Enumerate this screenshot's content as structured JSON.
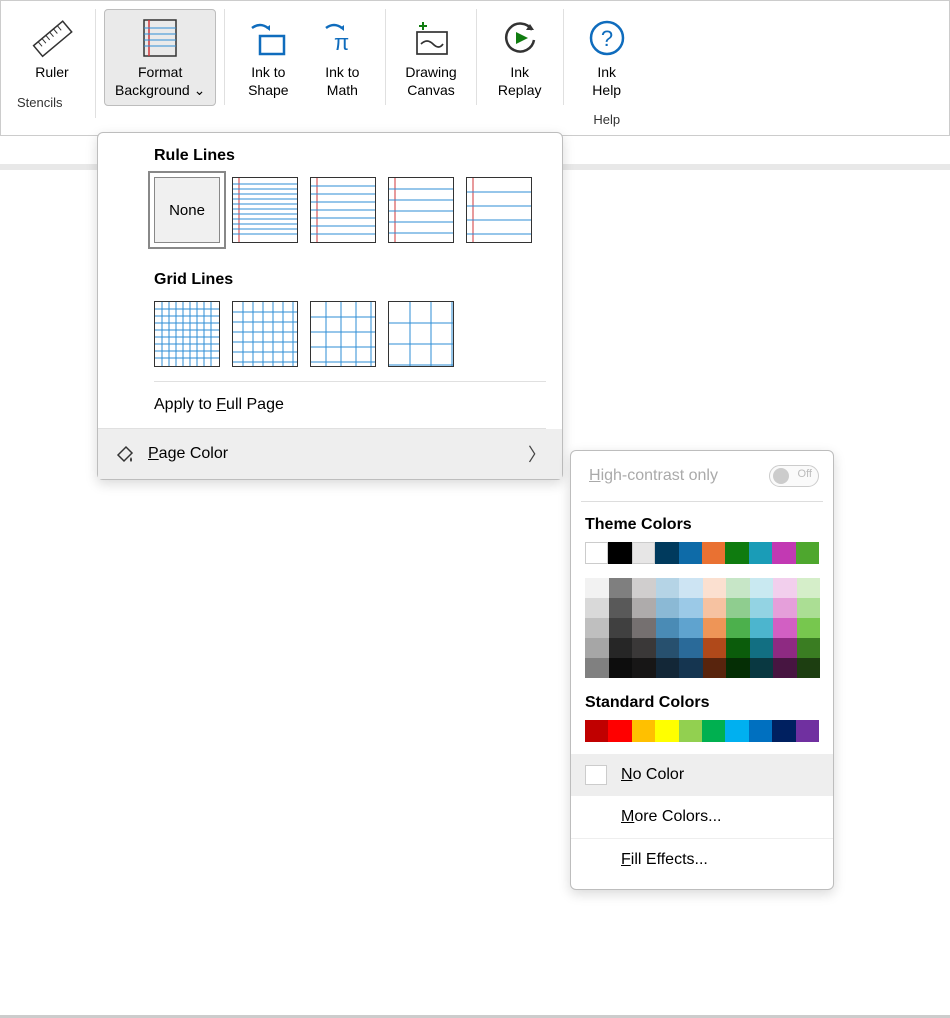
{
  "ribbon": {
    "groups": {
      "stencils": {
        "label": "Stencils",
        "ruler": "Ruler"
      },
      "format": {
        "button": "Format\nBackground"
      },
      "ink": {
        "ink_to_shape": "Ink to\nShape",
        "ink_to_math": "Ink to\nMath",
        "drawing_canvas": "Drawing\nCanvas",
        "ink_replay": "Ink\nReplay"
      },
      "help": {
        "label": "Help",
        "ink_help": "Ink\nHelp"
      }
    }
  },
  "dropdown1": {
    "rule_lines_title": "Rule Lines",
    "grid_lines_title": "Grid Lines",
    "none_label": "None",
    "apply_full_page": "Apply to Full Page",
    "page_color": "Page Color"
  },
  "dropdown2": {
    "high_contrast": "High-contrast only",
    "toggle_off": "Off",
    "theme_colors": "Theme Colors",
    "standard_colors": "Standard Colors",
    "no_color": "No Color",
    "more_colors": "More Colors...",
    "fill_effects": "Fill Effects...",
    "theme_row": [
      "#ffffff",
      "#000000",
      "#e7e6e6",
      "#003a5d",
      "#0e6ba8",
      "#e97132",
      "#0f7b0f",
      "#1a9cb7",
      "#c239b3",
      "#4ea72e"
    ],
    "theme_tints": [
      [
        "#f2f2f2",
        "#d9d9d9",
        "#bfbfbf",
        "#a6a6a6",
        "#808080"
      ],
      [
        "#7f7f7f",
        "#595959",
        "#404040",
        "#262626",
        "#0d0d0d"
      ],
      [
        "#d0cece",
        "#aeabab",
        "#757070",
        "#3a3838",
        "#171616"
      ],
      [
        "#b5d4e6",
        "#8bb9d5",
        "#4a8bb5",
        "#27506e",
        "#132737"
      ],
      [
        "#cde4f3",
        "#9bc9e7",
        "#5fa3cf",
        "#2a6a99",
        "#153550"
      ],
      [
        "#fbe0d0",
        "#f6c2a1",
        "#ee9557",
        "#b0491a",
        "#58240d"
      ],
      [
        "#c7e6c7",
        "#8fcd8f",
        "#4cb04c",
        "#0b5c0b",
        "#052e05"
      ],
      [
        "#c9e9f1",
        "#93d3e3",
        "#4cb5ce",
        "#126f82",
        "#093841"
      ],
      [
        "#f2cfed",
        "#e59fda",
        "#d25fc3",
        "#8e2a82",
        "#471541"
      ],
      [
        "#d5eec9",
        "#abde94",
        "#77c74e",
        "#3a7d22",
        "#1d3e11"
      ]
    ],
    "standard_row": [
      "#c00000",
      "#ff0000",
      "#ffc000",
      "#ffff00",
      "#92d050",
      "#00b050",
      "#00b0f0",
      "#0070c0",
      "#002060",
      "#7030a0"
    ]
  }
}
